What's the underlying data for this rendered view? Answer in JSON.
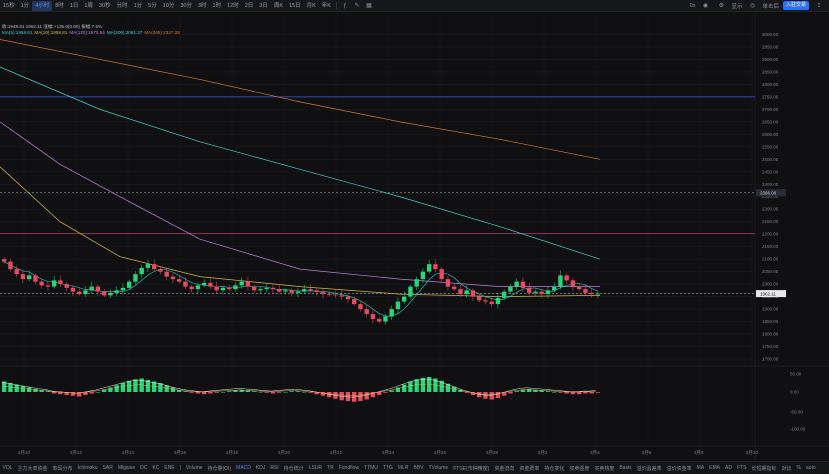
{
  "toolbar": {
    "timeframes": [
      "15秒",
      "1分",
      "4小时",
      "8时",
      "1日",
      "1周",
      "30秒",
      "分时",
      "1分",
      "5分",
      "10分",
      "30分",
      "3时",
      "1时",
      "12时",
      "2日",
      "3日",
      "周K",
      "15日",
      "月K",
      "年K"
    ],
    "active_index": 2,
    "right_labels": {
      "badge": "0s",
      "display": "显示",
      "settings": "单击后",
      "pill": "入驻交易"
    }
  },
  "info": {
    "line1": "收:1948.81  1962.11  涨幅:+135.0(0.00)  振幅:7.5%",
    "ma": [
      {
        "label": "MA(5):1958.61",
        "color": "#2fd0d0"
      },
      {
        "label": "MA(10):1958.81",
        "color": "#d6b84a"
      },
      {
        "label": "MA(120):1970.54",
        "color": "#c07fe0"
      },
      {
        "label": "MA(200):2061.37",
        "color": "#4bd1c9"
      },
      {
        "label": "MA(365):2327.28",
        "color": "#d67a35"
      }
    ]
  },
  "price_axis": {
    "labels": [
      "3000.00",
      "2950.00",
      "2900.00",
      "2850.00",
      "2800.00",
      "2750.00",
      "2700.00",
      "2650.00",
      "2600.00",
      "2550.00",
      "2500.00",
      "2450.00",
      "2400.00",
      "2350.00",
      "2300.00",
      "2250.00",
      "2200.00",
      "2150.00",
      "2100.00",
      "2050.00",
      "2000.00",
      "1950.00",
      "1900.00",
      "1850.00",
      "1800.00",
      "1750.00",
      "1700.00"
    ],
    "current_price": "1962.11",
    "mid_tag": "2366.09"
  },
  "macd_axis": {
    "labels": [
      "50.00",
      "0.00",
      "-50.00",
      "-100.00"
    ]
  },
  "dates": [
    "2月10",
    "2月12",
    "2月14",
    "2月16",
    "2月18",
    "2月20",
    "2月22",
    "2月24",
    "2月26",
    "2月28",
    "3月2",
    "3月4",
    "3月6",
    "3月8",
    "3月10"
  ],
  "indicators": {
    "items": [
      "VOL",
      "主力大单资金",
      "筹码分布",
      "Ichimoku",
      "SAR",
      "Migaise",
      "DC",
      "KC",
      "ENE",
      "|",
      "Volume",
      "持仓量(OI)",
      "MACD",
      "KDJ",
      "RSI",
      "持仓统计",
      "LSUR",
      "TR",
      "Fundflow",
      "TTMU",
      "TTG",
      "MLR",
      "BBV",
      "TVolume",
      "FTSE(市种精度)",
      "资金流向",
      "资金费率",
      "持仓变化",
      "买卖强度",
      "买卖热度",
      "Basis",
      "溢价盈差率",
      "溢价资金率",
      "MA",
      "EMA",
      "AD",
      "FTS",
      "长短期指标",
      "对比",
      "%",
      "auto"
    ],
    "active_index": 12
  },
  "colors": {
    "up": "#25d67a",
    "down": "#e84a5f",
    "bg": "#101012",
    "grid": "#1d1e22"
  },
  "chart_data": {
    "type": "candlestick",
    "y_range": [
      1680,
      3050
    ],
    "overlays": [
      {
        "name": "MA(365)",
        "color": "#d67a35",
        "points": [
          [
            0,
            2980
          ],
          [
            100,
            2900
          ],
          [
            200,
            2820
          ],
          [
            300,
            2730
          ],
          [
            400,
            2650
          ],
          [
            500,
            2580
          ],
          [
            600,
            2500
          ]
        ]
      },
      {
        "name": "MA(200)",
        "color": "#4bd1c9",
        "points": [
          [
            0,
            2870
          ],
          [
            100,
            2700
          ],
          [
            200,
            2570
          ],
          [
            300,
            2460
          ],
          [
            400,
            2350
          ],
          [
            500,
            2230
          ],
          [
            600,
            2100
          ]
        ]
      },
      {
        "name": "MA(120)",
        "color": "#c07fe0",
        "points": [
          [
            0,
            2650
          ],
          [
            60,
            2480
          ],
          [
            120,
            2350
          ],
          [
            200,
            2180
          ],
          [
            300,
            2060
          ],
          [
            400,
            2020
          ],
          [
            500,
            1990
          ],
          [
            600,
            1990
          ]
        ]
      },
      {
        "name": "MA(10)",
        "color": "#d6b84a",
        "points": [
          [
            0,
            2470
          ],
          [
            60,
            2250
          ],
          [
            120,
            2110
          ],
          [
            200,
            2030
          ],
          [
            300,
            1990
          ],
          [
            400,
            1960
          ],
          [
            500,
            1950
          ],
          [
            600,
            1955
          ]
        ]
      }
    ],
    "horizontal_lines": [
      {
        "price": 2750,
        "color": "#3b5bd9"
      },
      {
        "price": 2203,
        "color": "#c94770"
      },
      {
        "price": 2366,
        "color": "#8a8f99",
        "dashed": true
      },
      {
        "price": 1962,
        "color": "#8a8f99",
        "dashed": true
      }
    ],
    "close_series": [
      2090,
      2060,
      2040,
      2020,
      2035,
      2010,
      1995,
      1990,
      2015,
      2000,
      1985,
      1970,
      1960,
      1975,
      1990,
      1970,
      1955,
      1965,
      1975,
      1985,
      2010,
      2040,
      2065,
      2080,
      2060,
      2050,
      2030,
      2020,
      2010,
      1990,
      1980,
      1995,
      2005,
      1990,
      1975,
      1985,
      1980,
      1995,
      2010,
      1990,
      1975,
      1980,
      1985,
      1980,
      1970,
      1975,
      1965,
      1970,
      1980,
      1975,
      1968,
      1960,
      1958,
      1955,
      1950,
      1940,
      1920,
      1900,
      1880,
      1860,
      1850,
      1870,
      1900,
      1930,
      1950,
      1990,
      2020,
      2050,
      2080,
      2060,
      2020,
      1990,
      1980,
      1960,
      1975,
      1950,
      1935,
      1930,
      1920,
      1945,
      1970,
      1990,
      2010,
      1985,
      1965,
      1970,
      1960,
      1975,
      1990,
      2035,
      2015,
      1990,
      1980,
      1965,
      1960,
      1962
    ],
    "macd_hist": [
      14,
      12,
      10,
      8,
      6,
      4,
      2,
      1,
      -2,
      -3,
      -4,
      -5,
      -6,
      -4,
      -2,
      0,
      3,
      6,
      9,
      12,
      15,
      17,
      18,
      16,
      14,
      12,
      9,
      6,
      3,
      1,
      -1,
      -2,
      -3,
      -2,
      -1,
      0,
      1,
      2,
      3,
      2,
      1,
      0,
      -1,
      -2,
      -1,
      0,
      1,
      1,
      0,
      -1,
      -3,
      -5,
      -7,
      -9,
      -11,
      -12,
      -13,
      -12,
      -10,
      -7,
      -4,
      -1,
      2,
      6,
      10,
      14,
      17,
      19,
      20,
      18,
      15,
      11,
      7,
      3,
      -1,
      -4,
      -7,
      -9,
      -10,
      -8,
      -5,
      -2,
      1,
      3,
      4,
      3,
      2,
      1,
      0,
      -1,
      -2,
      -3,
      -3,
      -2,
      -2,
      -1
    ]
  }
}
